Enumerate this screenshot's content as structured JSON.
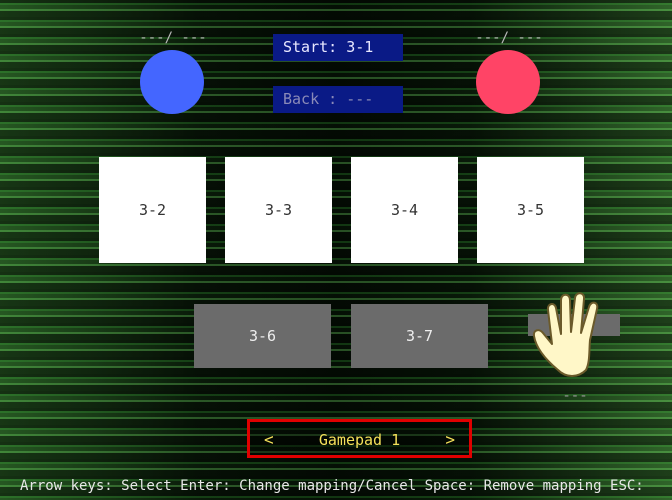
{
  "player_left": {
    "score": "---/ ---",
    "color": "#4466ff"
  },
  "player_right": {
    "score": "---/ ---",
    "color": "#ff4466"
  },
  "start_label": "Start: 3-1",
  "back_label": "Back : ---",
  "tiles_row1": [
    "3-2",
    "3-3",
    "3-4",
    "3-5"
  ],
  "tiles_row2": [
    "3-6",
    "3-7"
  ],
  "extra_slot_dashes": "---",
  "device_selector": {
    "prev": "<",
    "label": "Gamepad 1",
    "next": ">"
  },
  "footer_hint": "Arrow keys: Select  Enter: Change mapping/Cancel  Space: Remove mapping  ESC:"
}
